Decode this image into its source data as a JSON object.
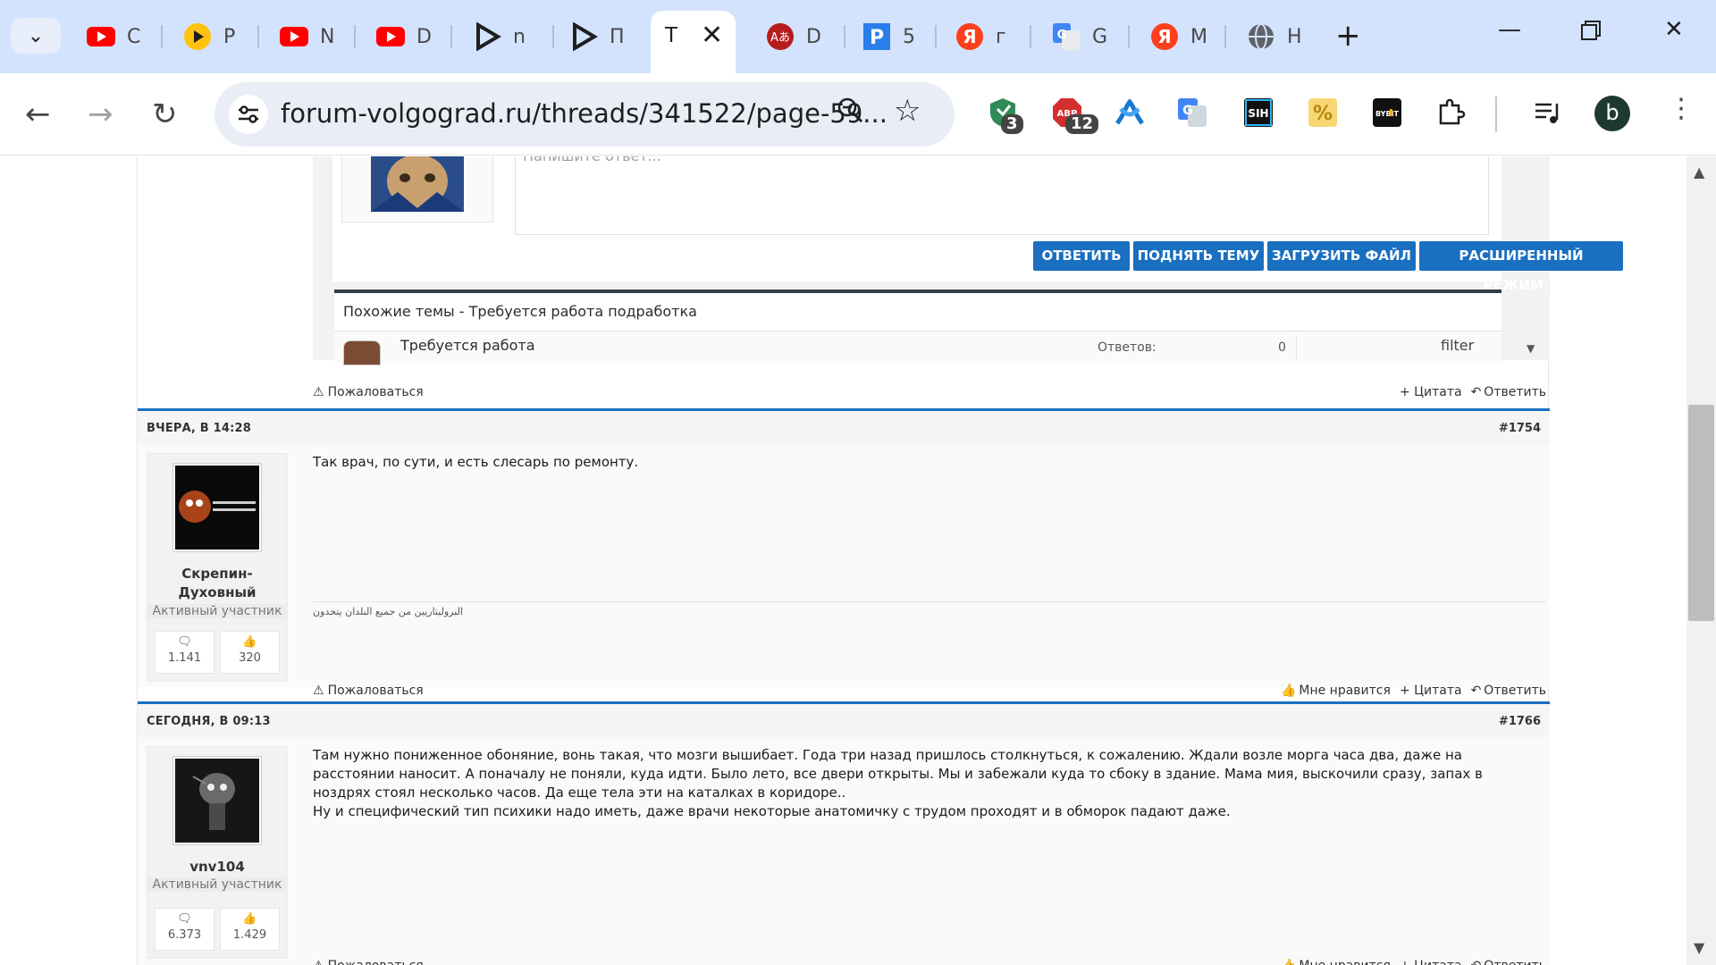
{
  "browser": {
    "tabs": [
      {
        "icon": "youtube-icon",
        "title": "C"
      },
      {
        "icon": "play-circle-icon",
        "title": "P"
      },
      {
        "icon": "youtube-icon",
        "title": "N"
      },
      {
        "icon": "youtube-icon",
        "title": "D"
      },
      {
        "icon": "play-triangle-icon",
        "title": "n"
      },
      {
        "icon": "play-triangle-icon",
        "title": "П"
      },
      {
        "icon": "none",
        "title": "Т",
        "active": true
      },
      {
        "icon": "translate-red-icon",
        "title": "D"
      },
      {
        "icon": "p-square-icon",
        "title": "5"
      },
      {
        "icon": "yandex-icon",
        "title": "г"
      },
      {
        "icon": "google-translate-icon",
        "title": "G"
      },
      {
        "icon": "yandex-icon",
        "title": "М"
      },
      {
        "icon": "globe-icon",
        "title": "Н"
      }
    ],
    "url": "forum-volgograd.ru/threads/341522/page-59...",
    "extensions": [
      {
        "name": "shield-extension-icon",
        "badge": "3",
        "color": "#2e8b57"
      },
      {
        "name": "adblock-extension-icon",
        "badge": "12",
        "color": "#d32f2f"
      },
      {
        "name": "ribbon-extension-icon",
        "badge": "",
        "color": "#1976d2"
      },
      {
        "name": "translate-extension-icon",
        "badge": "",
        "color": "#4285f4"
      },
      {
        "name": "sih-extension-icon",
        "badge": "",
        "label": "SIH",
        "color": "#111111"
      },
      {
        "name": "percent-extension-icon",
        "badge": "",
        "label": "%",
        "color": "#f5c542"
      },
      {
        "name": "bybit-extension-icon",
        "badge": "",
        "label": "BYBIT",
        "color": "#111111"
      }
    ],
    "profile_initial": "b"
  },
  "frame": {
    "reply_placeholder": "Напишите ответ...",
    "buttons": [
      "ОТВЕТИТЬ",
      "ПОДНЯТЬ ТЕМУ",
      "ЗАГРУЗИТЬ ФАЙЛ",
      "РАСШИРЕННЫЙ РЕЖИМ..."
    ],
    "similar_title": "Похожие темы - Требуется работа подработка",
    "similar_row": {
      "thread": "Требуется работа",
      "answers_label": "Ответов:",
      "answers": "0",
      "filter": "filter"
    }
  },
  "actions": {
    "report": "Пожаловаться",
    "quote": "+ Цитата",
    "reply": "Ответить",
    "like": "Мне нравится"
  },
  "posts": [
    {
      "date": "ВЧЕРА, В 14:28",
      "number": "#1754",
      "author": "Скрепин-Духовный",
      "author_line1": "Скрепин-",
      "author_line2": "Духовный",
      "user_title": "Активный участник",
      "messages": "1.141",
      "likes": "320",
      "text": "Так врач, по сути, и есть слесарь по ремонту.",
      "signature": "البروليتاريين من جميع البلدان يتحدون"
    },
    {
      "date": "СЕГОДНЯ, В 09:13",
      "number": "#1766",
      "author": "vnv104",
      "user_title": "Активный участник",
      "messages": "6.373",
      "likes": "1.429",
      "text_p1": "Там нужно пониженное обоняние, вонь такая, что мозги вышибает. Года три назад пришлось столкнуться, к сожалению. Ждали возле морга часа два, даже на расстоянии наносит. А поначалу не поняли, куда идти. Было лето, все двери открыты. Мы и забежали куда то сбоку в здание. Мама мия, выскочили сразу, запах в ноздрях стоял несколько часов. Да еще тела эти на каталках в коридоре..",
      "text_p2": "Ну и специфический тип психики надо иметь, даже врачи некоторые анатомичку с трудом проходят и в обморок падают даже."
    }
  ]
}
